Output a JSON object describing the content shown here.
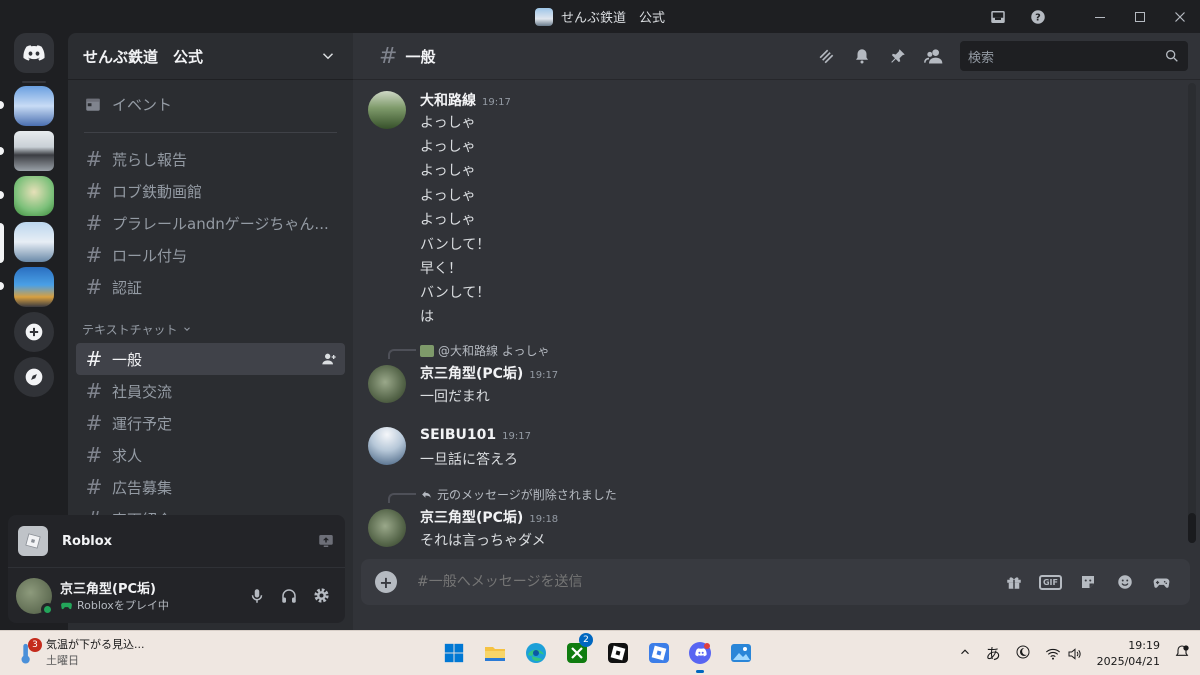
{
  "window": {
    "title": "せんぶ鉄道　公式"
  },
  "server": {
    "name": "せんぶ鉄道　公式"
  },
  "sidebar": {
    "events_label": "イベント",
    "channels_top": [
      {
        "label": "荒らし報告"
      },
      {
        "label": "ロブ鉄動画館"
      },
      {
        "label": "プラレールandnゲージちゃん..."
      },
      {
        "label": "ロール付与"
      },
      {
        "label": "認証"
      }
    ],
    "category": "テキストチャット",
    "channels_text": [
      {
        "label": "一般",
        "active": true
      },
      {
        "label": "社員交流"
      },
      {
        "label": "運行予定"
      },
      {
        "label": "求人"
      },
      {
        "label": "広告募集"
      },
      {
        "label": "車両紹介"
      }
    ]
  },
  "activity": {
    "game": "Roblox"
  },
  "user": {
    "name": "京三角型(PC垢)",
    "status": "Robloxをプレイ中"
  },
  "chat": {
    "channel": "一般",
    "search_placeholder": "検索",
    "composer_placeholder": "#一般へメッセージを送信",
    "gif_label": "GIF",
    "messages": [
      {
        "author": "大和路線",
        "time": "19:17",
        "lines": [
          "よっしゃ",
          "よっしゃ",
          "よっしゃ",
          "よっしゃ",
          "よっしゃ",
          "バンして！",
          "早く！",
          "バンして！",
          "は"
        ]
      },
      {
        "reply": "@大和路線 よっしゃ",
        "author": "京三角型(PC垢)",
        "time": "19:17",
        "lines": [
          "一回だまれ"
        ]
      },
      {
        "author": "SEIBU101",
        "time": "19:17",
        "lines": [
          "一旦話に答えろ"
        ]
      },
      {
        "reply": "元のメッセージが削除されました",
        "author": "京三角型(PC垢)",
        "time": "19:18",
        "lines": [
          "それは言っちゃダメ"
        ]
      }
    ]
  },
  "taskbar": {
    "weather_text": "気温が下がる見込...",
    "weather_sub": "土曜日",
    "weather_badge": "3",
    "xbox_badge": "2",
    "ime": "あ",
    "time": "19:19",
    "date": "2025/04/21"
  },
  "colors": {
    "blurple": "#5865f2",
    "online": "#23a55a",
    "bg_main": "#313338",
    "bg_sidebar": "#2b2d31"
  }
}
